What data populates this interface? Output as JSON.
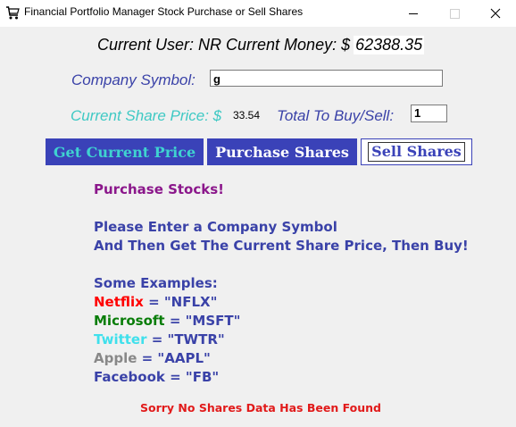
{
  "window": {
    "title": "Financial Portfolio Manager Stock Purchase or Sell Shares",
    "app_icon": "shopping-cart-icon"
  },
  "user_bar": {
    "prefix": "Current User: NR Current Money: $",
    "money": "62388.35"
  },
  "symbol": {
    "label": "Company Symbol:",
    "value": "g"
  },
  "price": {
    "label": "Current Share Price: $",
    "value": "33.54"
  },
  "total": {
    "label": "Total To Buy/Sell:",
    "value": "1"
  },
  "buttons": {
    "get_price": "Get Current Price",
    "purchase": "Purchase Shares",
    "sell": "Sell Shares"
  },
  "info": {
    "title": "Purchase Stocks!",
    "line1": "Please Enter a Company Symbol",
    "line2": "And Then Get The Current Share Price, Then Buy!",
    "examples_heading": "Some Examples:",
    "examples": [
      {
        "name": "Netflix",
        "symbol": " = \"NFLX\"",
        "color": "#ff0000"
      },
      {
        "name": "Microsoft",
        "symbol": " = \"MSFT\"",
        "color": "#087d08"
      },
      {
        "name": "Twitter",
        "symbol": " = \"TWTR\"",
        "color": "#3fe0ec"
      },
      {
        "name": "Apple",
        "symbol": " = \"AAPL\"",
        "color": "#888888"
      },
      {
        "name": "Facebook",
        "symbol": " = \"FB\"",
        "color": "#3a42a8"
      }
    ]
  },
  "status": {
    "message": "Sorry No Shares Data Has Been Found",
    "color": "#e11a1a"
  }
}
